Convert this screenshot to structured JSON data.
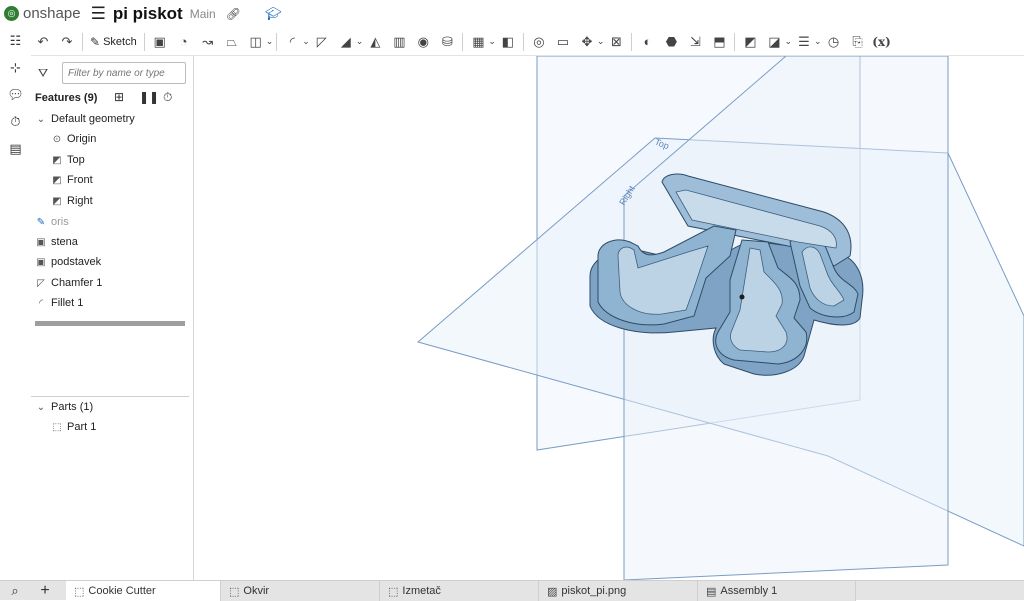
{
  "app": {
    "name": "onshape",
    "document_title": "pi piskot",
    "branch": "Main"
  },
  "toolbar": {
    "sketch_label": "Sketch",
    "variable_label": "(x)"
  },
  "feature_panel": {
    "filter_placeholder": "Filter by name or type",
    "features_title": "Features (9)",
    "default_geometry_label": "Default geometry",
    "default_geometry": [
      "Origin",
      "Top",
      "Front",
      "Right"
    ],
    "features": [
      {
        "label": "oris",
        "icon": "sketch-icon",
        "suppressed": true
      },
      {
        "label": "stena",
        "icon": "extrude-icon"
      },
      {
        "label": "podstavek",
        "icon": "extrude-icon"
      },
      {
        "label": "Chamfer 1",
        "icon": "chamfer-icon"
      },
      {
        "label": "Fillet 1",
        "icon": "fillet-icon"
      }
    ],
    "parts_title": "Parts (1)",
    "parts": [
      "Part 1"
    ]
  },
  "viewport": {
    "plane_labels": {
      "top": "Top",
      "right": "Right"
    }
  },
  "tabs": [
    {
      "label": "Cookie Cutter",
      "icon": "part-studio-icon",
      "active": true
    },
    {
      "label": "Okvir",
      "icon": "part-studio-icon"
    },
    {
      "label": "Izmetač",
      "icon": "part-studio-icon"
    },
    {
      "label": "piskot_pi.png",
      "icon": "image-icon"
    },
    {
      "label": "Assembly 1",
      "icon": "assembly-icon"
    }
  ],
  "colors": {
    "brand": "#2e7d32",
    "plane_stroke": "#7a9cc6",
    "plane_fill": "#e8f1fb",
    "part_face": "#8fb4d2",
    "part_dark": "#4d7496"
  }
}
